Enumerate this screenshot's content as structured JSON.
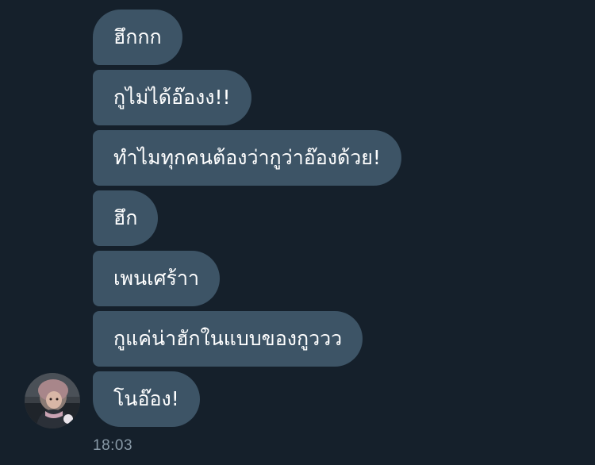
{
  "conversation": {
    "messages": [
      {
        "text": "ฮึกกก"
      },
      {
        "text": "กูไม่ได้อ๊องง!!"
      },
      {
        "text": "ทำไมทุกคนต้องว่ากูว่าอ๊องด้วย!"
      },
      {
        "text": "ฮึก"
      },
      {
        "text": "เพนเศร้าา"
      },
      {
        "text": "กูแค่น่าฮักในแบบของกูววว"
      },
      {
        "text": "โนอ๊อง!"
      }
    ],
    "timestamp": "18:03"
  },
  "colors": {
    "background": "#15202b",
    "bubble": "#3d5466",
    "text": "#ffffff",
    "timestamp": "#8899a6"
  },
  "avatar": {
    "icon": "user-avatar-photo"
  }
}
